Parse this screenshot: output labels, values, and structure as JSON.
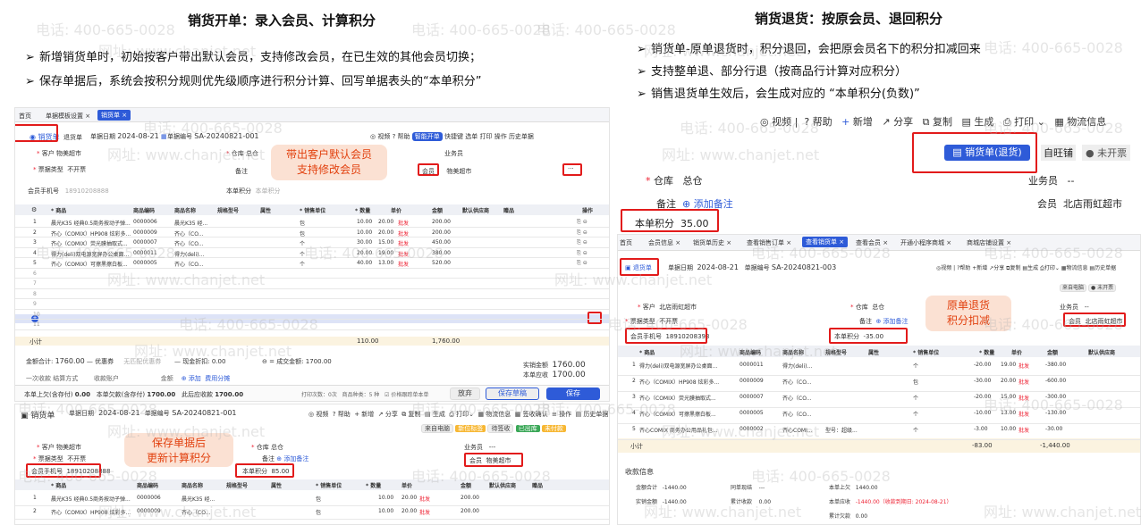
{
  "left": {
    "title": "销货开单：录入会员、计算积分",
    "bullets": [
      "新增销货单时，初始按客户带出默认会员，支持修改会员，在已生效的其他会员切换；",
      "保存单据后，系统会按积分规则优先级顺序进行积分计算、回写单据表头的“本单积分”"
    ],
    "shot1": {
      "tabs": [
        "首页",
        "单据模板设置 ×",
        "销货单 ×"
      ],
      "doc_type": "销货单",
      "doc_sub": "退货单",
      "date_label": "单据日期",
      "date": "2024-08-21",
      "no_label": "单据编号",
      "no": "SA-20240821-001",
      "toolbar": [
        "视频",
        "帮助",
        "智能开单",
        "快捷键",
        "选单",
        "打印",
        "操作",
        "历史单据"
      ],
      "customer_label": "客户",
      "customer": "物美超市",
      "warehouse_label": "仓库",
      "warehouse": "总仓",
      "salesman_label": "业务员",
      "invoice_label": "票据类型",
      "invoice": "不开票",
      "remark_label": "备注",
      "member_label": "会员",
      "member": "物美超市",
      "phone_label": "会员手机号",
      "phone": "18910208888",
      "points_label": "本单积分",
      "points_ph": "本单积分",
      "callout": [
        "带出客户默认会员",
        "支持修改会员"
      ],
      "headers": [
        "商品",
        "商品编码",
        "商品名称",
        "规格型号",
        "属性",
        "销售单位",
        "数量",
        "单价",
        "金额",
        "默认供应商",
        "赠品",
        "操作"
      ],
      "rows": [
        [
          "1",
          "晨光K35 经典0.5商务按动子弹...",
          "0000006",
          "晨光K35 经...",
          "",
          "",
          "包",
          "10.00",
          "20.00",
          "批发",
          "200.00"
        ],
        [
          "2",
          "齐心（COMIX）HP908 炫彩多...",
          "0000009",
          "齐心（CO...",
          "",
          "",
          "包",
          "10.00",
          "20.00",
          "批发",
          "200.00"
        ],
        [
          "3",
          "齐心（COMIX）荧光膜抽取式...",
          "0000007",
          "齐心（CO...",
          "",
          "",
          "个",
          "30.00",
          "15.00",
          "批发",
          "450.00"
        ],
        [
          "4",
          "得力(deli)双电源宽屏办公桌面...",
          "0000011",
          "得力(deli)...",
          "",
          "",
          "个",
          "20.00",
          "19.00",
          "批发",
          "380.00"
        ],
        [
          "5",
          "齐心（COMIX）可擦黑擦白板...",
          "0000005",
          "齐心（CO...",
          "",
          "",
          "个",
          "40.00",
          "13.00",
          "批发",
          "520.00"
        ]
      ],
      "subtotal_label": "小计",
      "subtotal_qty": "110.00",
      "subtotal_amt": "1,760.00",
      "total_label": "金额合计",
      "total": "1760.00",
      "discount_label": "优惠券",
      "no_coupon": "无匹配优惠券",
      "cash_label": "现金折扣",
      "cash": "0.00",
      "deal_label": "成交金额",
      "deal": "1700.00",
      "receipt_label": "实销金额",
      "receipt": "1760.00",
      "received_label": "本单应收",
      "received": "1700.00",
      "payment_labels": [
        "一次收款 结算方式",
        "收款账户",
        "金额",
        "添加",
        "费用分摊"
      ],
      "footer": [
        "本单上欠(含存付)",
        "0.00",
        "本单欠款(含存付)",
        "1700.00",
        "此后应收款",
        "1700.00"
      ],
      "print_label": "打印次数：0次",
      "count_label": "商品种类：5 种",
      "check_label": "价格跟踪单本单",
      "btn_draft": "放弃",
      "btn_save_new": "保存草稿",
      "btn_save": "保存"
    },
    "shot2": {
      "doc_type": "销货单",
      "date_label": "单据日期",
      "date": "2024-08-21",
      "no_label": "单据编号",
      "no": "SA-20240821-001",
      "toolbar": [
        "视频",
        "帮助",
        "新增",
        "分享",
        "复制",
        "生成",
        "打印",
        "物流信息",
        "签收确认",
        "操作",
        "历史单据"
      ],
      "status": [
        "来自电脑",
        "新位标签",
        "待签收",
        "已出库",
        "未付款"
      ],
      "customer_label": "客户",
      "customer": "物美超市",
      "warehouse_label": "仓库",
      "warehouse": "总仓",
      "salesman_label": "业务员",
      "salesman": "---",
      "invoice_label": "票据类型",
      "invoice": "不开票",
      "remark_label": "备注",
      "add_remark": "添加备注",
      "member_label": "会员",
      "member": "物美超市",
      "phone_label": "会员手机号",
      "phone": "18910208888",
      "points_label": "本单积分",
      "points": "85.00",
      "callout": [
        "保存单据后",
        "更新计算积分"
      ],
      "headers": [
        "商品",
        "商品编码",
        "商品名称",
        "规格型号",
        "属性",
        "销售单位",
        "数量",
        "单价",
        "金额",
        "默认供应商",
        "赠品"
      ],
      "rows": [
        [
          "1",
          "晨光K35 经典0.5商务按动子弹...",
          "0000006",
          "晨光K35 经...",
          "",
          "",
          "包",
          "10.00",
          "20.00",
          "批发",
          "200.00"
        ],
        [
          "2",
          "齐心（COMIX）HP908 炫彩多...",
          "0000009",
          "齐心（CO...",
          "",
          "",
          "包",
          "10.00",
          "20.00",
          "批发",
          "200.00"
        ]
      ]
    }
  },
  "right": {
    "title": "销货退货：按原会员、退回积分",
    "bullets": [
      "销货单-原单退货时，积分退回，会把原会员名下的积分扣减回来",
      "支持整单退、部分行退（按商品行计算对应积分）",
      "销售退货单生效后，会生成对应的 “本单积分(负数)”"
    ],
    "zoom": {
      "toolbar": [
        "视频",
        "帮助",
        "新增",
        "分享",
        "复制",
        "生成",
        "打印",
        "物流信息"
      ],
      "link_btn": "销货单(退货)",
      "shop": "自旺铺",
      "unpaid": "未开票",
      "warehouse_label": "仓库",
      "warehouse": "总仓",
      "salesman_label": "业务员",
      "salesman": "--",
      "remark_label": "备注",
      "add_remark": "添加备注",
      "member_label": "会员",
      "member": "北店雨虹超市",
      "points_label": "本单积分",
      "points": "35.00"
    },
    "shot": {
      "tabs": [
        "首页",
        "会员信息 ×",
        "销货单历史 ×",
        "查看销售订单 ×",
        "查看销货单 ×",
        "查看会员 ×",
        "开通小程序商城 ×",
        "商城店铺设置 ×"
      ],
      "doc_type": "退货单",
      "date_label": "单据日期",
      "date": "2024-08-21",
      "no_label": "单据编号",
      "no": "SA-20240821-003",
      "toolbar": [
        "视频",
        "帮助",
        "新增",
        "分享",
        "复制",
        "生成",
        "打印",
        "物流信息",
        "历史单据"
      ],
      "status": [
        "来自电脑",
        "未开票"
      ],
      "customer_label": "客户",
      "customer": "北店雨虹超市",
      "warehouse_label": "仓库",
      "warehouse": "总仓",
      "salesman_label": "业务员",
      "salesman": "--",
      "invoice_label": "票据类型",
      "invoice": "不开票",
      "remark_label": "备注",
      "add_remark": "添加备注",
      "member_label": "会员",
      "member": "北店雨虹超市",
      "phone_label": "会员手机号",
      "phone": "18910208393",
      "points_label": "本单积分",
      "points": "-35.00",
      "callout": [
        "原单退货",
        "积分扣减"
      ],
      "headers": [
        "商品",
        "商品编码",
        "商品名称",
        "规格型号",
        "属性",
        "销售单位",
        "数量",
        "单价",
        "金额",
        "默认供应商"
      ],
      "rows": [
        [
          "1",
          "得力(deli)双电源宽屏办公桌面...",
          "0000011",
          "得力(deli)...",
          "",
          "",
          "个",
          "-20.00",
          "19.00",
          "批发",
          "-380.00"
        ],
        [
          "2",
          "齐心（COMIX）HP908 炫彩多...",
          "0000009",
          "齐心（CO...",
          "",
          "",
          "包",
          "-30.00",
          "20.00",
          "批发",
          "-600.00"
        ],
        [
          "3",
          "齐心（COMIX）荧光膜抽取式...",
          "0000007",
          "齐心（CO...",
          "",
          "",
          "个",
          "-20.00",
          "15.00",
          "批发",
          "-300.00"
        ],
        [
          "4",
          "齐心（COMIX）可擦黑擦白板...",
          "0000005",
          "齐心（CO...",
          "",
          "",
          "个",
          "-10.00",
          "13.00",
          "批发",
          "-130.00"
        ],
        [
          "5",
          "齐心COMIX 商务办公用品礼包...",
          "0000002",
          "齐心COMI...",
          "型号：超级...",
          "",
          "个",
          "-3.00",
          "10.00",
          "批发",
          "-30.00"
        ]
      ],
      "subtotal_label": "小计",
      "subtotal_qty": "-83.00",
      "subtotal_amt": "-1,440.00",
      "receipt_title": "收款信息",
      "r_total_label": "金额合计",
      "r_total": "-1440.00",
      "r_deal_label": "实销金额",
      "r_deal": "-1440.00",
      "r_same_label": "同单现结",
      "r_same": "---",
      "r_cum_label": "累计收款",
      "r_cum": "0.00",
      "r_prev_label": "本单上欠",
      "r_prev": "1440.00",
      "r_this_label": "本单应收",
      "r_this": "-1440.00（收款到期日: 2024-08-21）",
      "r_owe_label": "累计欠款",
      "r_owe": "0.00"
    }
  },
  "watermark": [
    "电话: 400-665-0028",
    "网址: www.chanjet.net"
  ],
  "colors": {
    "accent": "#2e5bd8",
    "highlight": "#e21b1b",
    "callout_bg": "#fbe1d3",
    "callout_text": "#e2410f"
  }
}
